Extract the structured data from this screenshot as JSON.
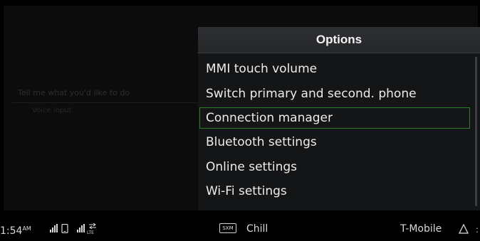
{
  "background": {
    "hint_text": "Tell me what you'd like to do",
    "hint_subtext": "Voice input"
  },
  "options": {
    "title": "Options",
    "selected_index": 2,
    "items": [
      {
        "label": "MMI touch volume"
      },
      {
        "label": "Switch primary and second. phone"
      },
      {
        "label": "Connection manager"
      },
      {
        "label": "Bluetooth settings"
      },
      {
        "label": "Online settings"
      },
      {
        "label": "Wi-Fi settings"
      }
    ]
  },
  "status_bar": {
    "time": "1:54",
    "ampm": "AM",
    "network_type": "LTE",
    "radio_source": "SXM",
    "station": "Chill",
    "carrier": "T-Mobile"
  },
  "colors": {
    "selection_border": "#2f7d2c",
    "panel_background": "#141516",
    "text": "#ececec"
  },
  "icons": [
    "signal-bars-icon",
    "phone-icon",
    "lte-signal-icon",
    "navigation-icon"
  ]
}
